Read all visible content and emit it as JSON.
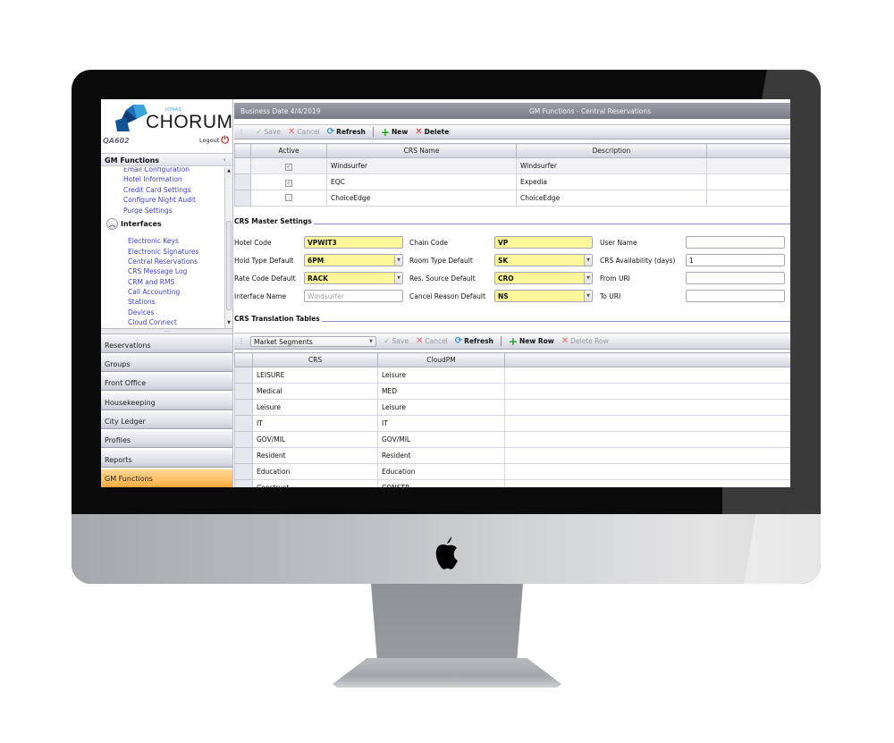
{
  "app": {
    "logo_small": "JONAS",
    "logo_main": "CHORUM",
    "property_code": "QA602",
    "logout_label": "Logout"
  },
  "sidebar": {
    "section_title": "GM Functions",
    "links_top": [
      "Email Configuration",
      "Hotel Information",
      "Credit Card Settings",
      "Configure Night Audit",
      "Purge Settings"
    ],
    "group_title": "Interfaces",
    "links_interfaces": [
      "Electronic Keys",
      "Electronic Signatures",
      "Central Reservations",
      "CRS Message Log",
      "CRM and RMS",
      "Call Accounting",
      "Stations",
      "Devices",
      "Cloud Connect"
    ],
    "modules": [
      "Reservations",
      "Groups",
      "Front Office",
      "Housekeeping",
      "City Ledger",
      "Profiles",
      "Reports",
      "GM Functions"
    ],
    "active_module": "GM Functions"
  },
  "header": {
    "business_date": "Business Date 4/4/2019",
    "title": "GM Functions - Central Reservations"
  },
  "toolbar": {
    "save": "Save",
    "cancel": "Cancel",
    "refresh": "Refresh",
    "new": "New",
    "delete": "Delete"
  },
  "crs_table": {
    "columns": [
      "Active",
      "CRS Name",
      "Description"
    ],
    "rows": [
      {
        "active": true,
        "name": "Windsurfer",
        "description": "Windsurfer"
      },
      {
        "active": true,
        "name": "EQC",
        "description": "Expedia"
      },
      {
        "active": false,
        "name": "ChoiceEdge",
        "description": "ChoiceEdge"
      }
    ]
  },
  "master_settings": {
    "title": "CRS Master Settings",
    "hotel_code": {
      "label": "Hotel Code",
      "value": "VPWIT3"
    },
    "hold_type": {
      "label": "Hold Type Default",
      "value": "6PM"
    },
    "rate_code": {
      "label": "Rate Code Default",
      "value": "RACK"
    },
    "interface_name": {
      "label": "Interface Name",
      "placeholder": "Windsurfer"
    },
    "chain_code": {
      "label": "Chain Code",
      "value": "VP"
    },
    "room_type": {
      "label": "Room Type Default",
      "value": "SK"
    },
    "res_source": {
      "label": "Res. Source Default",
      "value": "CRO"
    },
    "cancel_reason": {
      "label": "Cancel Reason Default",
      "value": "NS"
    },
    "user_name": {
      "label": "User Name",
      "value": ""
    },
    "crs_availability": {
      "label": "CRS Availability (days)",
      "value": "1"
    },
    "from_uri": {
      "label": "From URI",
      "value": ""
    },
    "to_uri": {
      "label": "To URI",
      "value": ""
    }
  },
  "translation": {
    "title": "CRS Translation Tables",
    "table_select": "Market Segments",
    "save": "Save",
    "cancel": "Cancel",
    "refresh": "Refresh",
    "new_row": "New Row",
    "delete_row": "Delete Row",
    "columns": [
      "CRS",
      "CloudPM"
    ],
    "rows": [
      [
        "LEISURE",
        "Leisure"
      ],
      [
        "Medical",
        "MED"
      ],
      [
        "Leisure",
        "Leisure"
      ],
      [
        "IT",
        "IT"
      ],
      [
        "GOV/MIL",
        "GOV/MIL"
      ],
      [
        "Resident",
        "Resident"
      ],
      [
        "Education",
        "Education"
      ],
      [
        "Construct",
        "CONSTR"
      ]
    ]
  }
}
